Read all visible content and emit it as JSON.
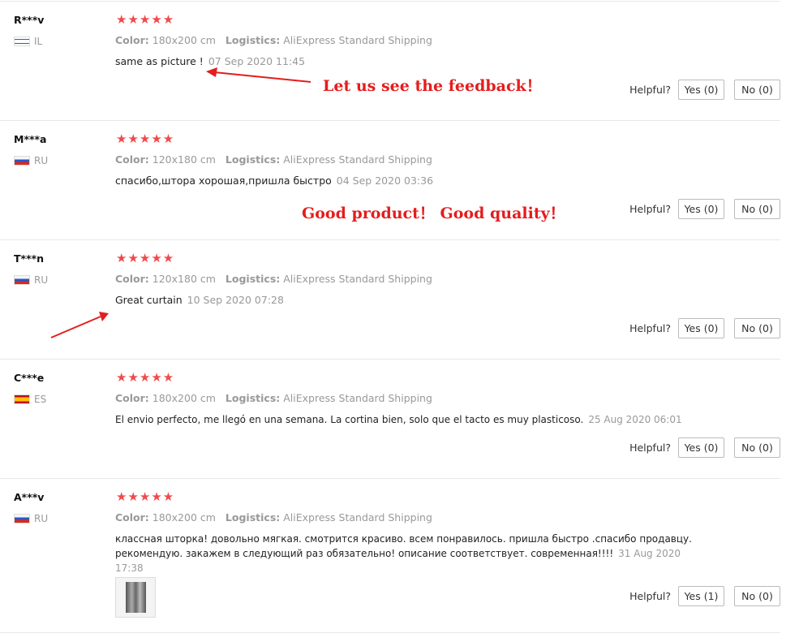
{
  "reviews": [
    {
      "user": "R***v",
      "country": "IL",
      "flag": "il",
      "stars": "★★★★★",
      "color_label": "Color:",
      "color": "180x200 cm",
      "logistics_label": "Logistics:",
      "logistics": "AliExpress Standard Shipping",
      "text": "same as picture !",
      "date": "07 Sep 2020 11:45",
      "helpful": "Helpful?",
      "yes": "Yes (0)",
      "no": "No (0)"
    },
    {
      "user": "M***a",
      "country": "RU",
      "flag": "ru",
      "stars": "★★★★★",
      "color_label": "Color:",
      "color": "120x180 cm",
      "logistics_label": "Logistics:",
      "logistics": "AliExpress Standard Shipping",
      "text": "спасибо,штора хорошая,пришла быстро",
      "date": "04 Sep 2020 03:36",
      "helpful": "Helpful?",
      "yes": "Yes (0)",
      "no": "No (0)"
    },
    {
      "user": "T***n",
      "country": "RU",
      "flag": "ru",
      "stars": "★★★★★",
      "color_label": "Color:",
      "color": "120x180 cm",
      "logistics_label": "Logistics:",
      "logistics": "AliExpress Standard Shipping",
      "text": "Great curtain",
      "date": "10 Sep 2020 07:28",
      "helpful": "Helpful?",
      "yes": "Yes (0)",
      "no": "No (0)"
    },
    {
      "user": "C***e",
      "country": "ES",
      "flag": "es",
      "stars": "★★★★★",
      "color_label": "Color:",
      "color": "180x200 cm",
      "logistics_label": "Logistics:",
      "logistics": "AliExpress Standard Shipping",
      "text": "El envio perfecto, me llegó en una semana. La cortina bien, solo que el tacto es muy plasticoso.",
      "date": "25 Aug 2020 06:01",
      "helpful": "Helpful?",
      "yes": "Yes (0)",
      "no": "No (0)"
    },
    {
      "user": "A***v",
      "country": "RU",
      "flag": "ru",
      "stars": "★★★★★",
      "color_label": "Color:",
      "color": "180x200 cm",
      "logistics_label": "Logistics:",
      "logistics": "AliExpress Standard Shipping",
      "text_line1": "классная шторка! довольно мягкая. смотрится красиво. всем понравилось. пришла быстро .спасибо продавцу.",
      "text_line2": "рекомендую. закажем в следующий раз обязательно! описание соответствует. современная!!!!",
      "date_part1": "31 Aug 2020",
      "date_part2": "17:38",
      "helpful": "Helpful?",
      "yes": "Yes (1)",
      "no": "No (0)"
    }
  ],
  "annotations": {
    "feedback": "Let us see the feedback！",
    "product": "Good product！ Good quality！"
  },
  "colors": {
    "accent": "#e41d1d",
    "stars": "#f04a4a"
  }
}
